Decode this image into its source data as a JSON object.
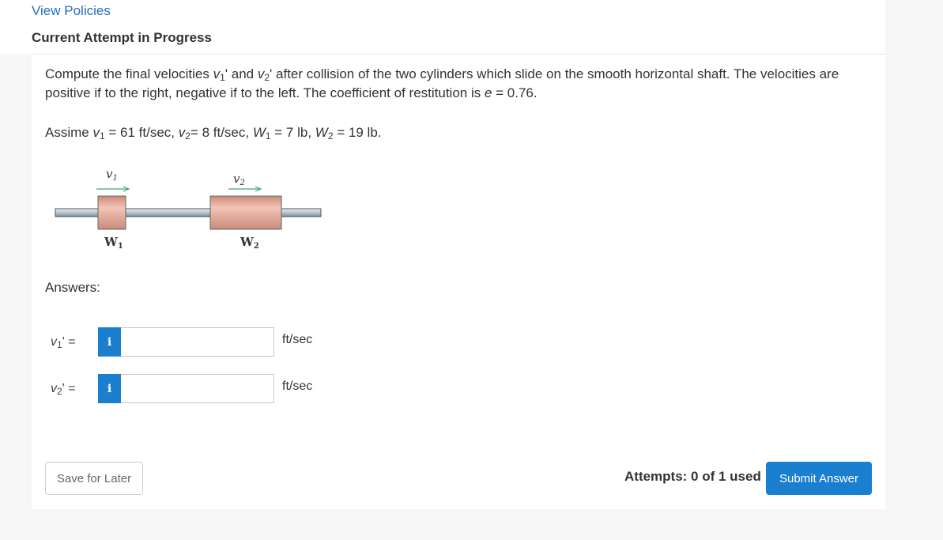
{
  "header": {
    "view_policies": "View Policies",
    "attempt_heading": "Current Attempt in Progress"
  },
  "question": {
    "text_1": "Compute the final velocities ",
    "v1": "v",
    "v1_sub": "1",
    "prime_and": "' and ",
    "v2": "v",
    "v2_sub": "2",
    "text_2": "' after collision of the two cylinders which slide on the smooth horizontal shaft. The velocities are positive if to the right, negative if to the left. The coefficient of restitution is ",
    "e_symbol": "e",
    "e_value": " = 0.76."
  },
  "assume": {
    "prefix": "Assime ",
    "v1": "v",
    "v1_sub": "1",
    "v1_val": " = 61 ft/sec, ",
    "v2": "v",
    "v2_sub": "2",
    "v2_val": "= 8 ft/sec, ",
    "w1": "W",
    "w1_sub": "1",
    "w1_val": " = 7 lb, ",
    "w2": "W",
    "w2_sub": "2",
    "w2_val": " = 19 lb."
  },
  "figure": {
    "v1_label": "v",
    "v1_sub": "1",
    "v2_label": "v",
    "v2_sub": "2",
    "w1_label": "W",
    "w1_sub": "1",
    "w2_label": "W",
    "w2_sub": "2"
  },
  "answers": {
    "label": "Answers:",
    "items": [
      {
        "var": "v",
        "sub": "1",
        "suffix": "' =",
        "info": "i",
        "value": "",
        "unit": "ft/sec"
      },
      {
        "var": "v",
        "sub": "2",
        "suffix": "' =",
        "info": "i",
        "value": "",
        "unit": "ft/sec"
      }
    ]
  },
  "footer": {
    "save_label": "Save for Later",
    "attempts_text": "Attempts: 0 of 1 used",
    "submit_label": "Submit Answer"
  },
  "colors": {
    "accent": "#1a7fcf",
    "link": "#2a6ebb",
    "cylinder": "#e0a898",
    "shaft": "#b8c4d0",
    "arrow": "#3aa872"
  }
}
